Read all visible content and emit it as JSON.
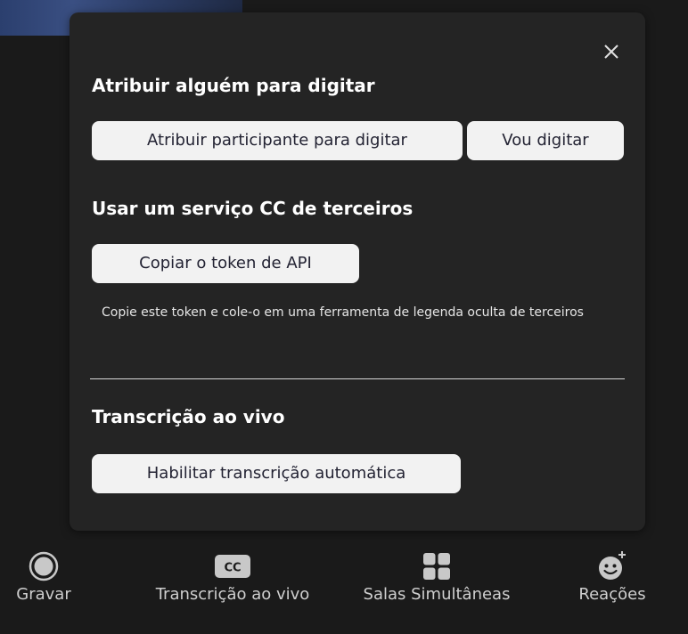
{
  "popup": {
    "close_icon": "close-icon",
    "manual": {
      "title": "Atribuir alguém para digitar",
      "assign_button": "Atribuir participante para digitar",
      "self_button": "Vou digitar"
    },
    "third_party": {
      "title": "Usar um serviço CC de terceiros",
      "copy_token_button": "Copiar o token de API",
      "hint": "Copie este token e cole-o em uma ferramenta de legenda oculta de terceiros"
    },
    "live_transcript": {
      "title": "Transcrição ao vivo",
      "enable_button": "Habilitar transcrição automática"
    }
  },
  "toolbar": {
    "items": [
      {
        "label": "Gravar",
        "icon": "record-icon"
      },
      {
        "label": "Transcrição ao vivo",
        "icon": "cc-icon",
        "icon_text": "CC"
      },
      {
        "label": "Salas Simultâneas",
        "icon": "breakout-rooms-icon"
      },
      {
        "label": "Reações",
        "icon": "reactions-icon"
      }
    ]
  },
  "colors": {
    "popup_bg": "#242424",
    "page_bg": "#1a1a1a",
    "button_bg": "#f2f2f2",
    "button_text": "#232333",
    "toolbar_label": "#cfcfcf"
  }
}
